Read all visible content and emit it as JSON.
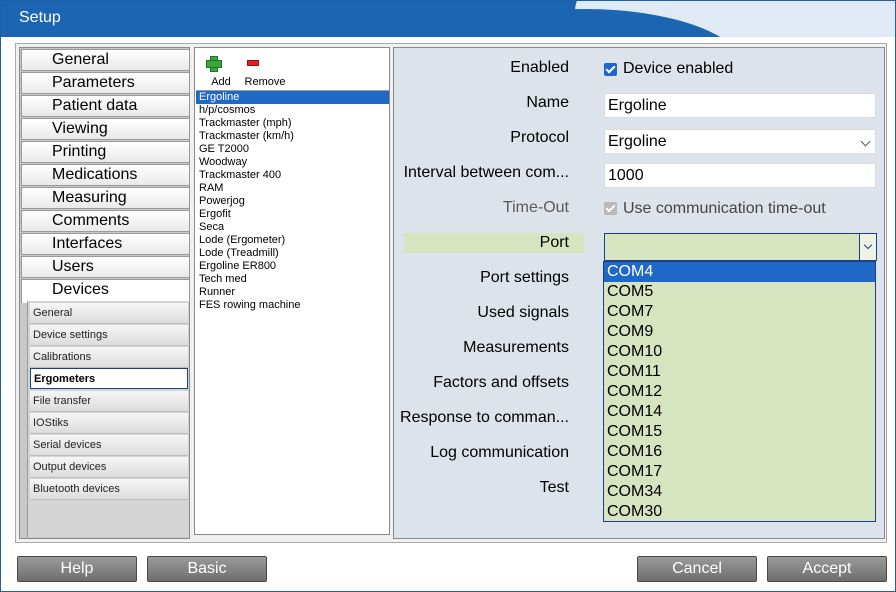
{
  "window": {
    "title": "Setup"
  },
  "menu": {
    "items": [
      "General",
      "Parameters",
      "Patient data",
      "Viewing",
      "Printing",
      "Medications",
      "Measuring",
      "Comments",
      "Interfaces",
      "Users",
      "Devices"
    ],
    "active": "Devices",
    "submenu": [
      "General",
      "Device settings",
      "Calibrations",
      "Ergometers",
      "File transfer",
      "IOStiks",
      "Serial devices",
      "Output devices",
      "Bluetooth devices"
    ],
    "submenu_selected": "Ergometers"
  },
  "toolbar": {
    "add_label": "Add",
    "remove_label": "Remove"
  },
  "devices": {
    "items": [
      "Ergoline",
      "h/p/cosmos",
      "Trackmaster (mph)",
      "Trackmaster (km/h)",
      "GE T2000",
      "Woodway",
      "Trackmaster 400",
      "RAM",
      "Powerjog",
      "Ergofit",
      "Seca",
      "Lode (Ergometer)",
      "Lode (Treadmill)",
      "Ergoline ER800",
      "Tech med",
      "Runner",
      "FES rowing machine"
    ],
    "selected": "Ergoline"
  },
  "config": {
    "labels": {
      "enabled": "Enabled",
      "name": "Name",
      "protocol": "Protocol",
      "interval": "Interval between com...",
      "timeout": "Time-Out",
      "port": "Port",
      "port_settings": "Port settings",
      "used_signals": "Used signals",
      "measurements": "Measurements",
      "factors": "Factors and offsets",
      "response": "Response to comman...",
      "log": "Log communication",
      "test": "Test"
    },
    "device_enabled_label": "Device enabled",
    "device_enabled": true,
    "name_value": "Ergoline",
    "protocol_value": "Ergoline",
    "interval_value": "1000",
    "use_timeout_label": "Use communication time-out",
    "use_timeout": true,
    "port_value": "",
    "port_options": [
      "COM4",
      "COM5",
      "COM7",
      "COM9",
      "COM10",
      "COM11",
      "COM12",
      "COM14",
      "COM15",
      "COM16",
      "COM17",
      "COM34",
      "COM30"
    ],
    "port_highlighted": "COM4"
  },
  "buttons": {
    "help": "Help",
    "basic": "Basic",
    "cancel": "Cancel",
    "accept": "Accept"
  },
  "colors": {
    "titlebar": "#1b65b3",
    "selection": "#1f68c8",
    "port_bg": "#d6e4c0",
    "panel_bg": "#dce3eb"
  }
}
